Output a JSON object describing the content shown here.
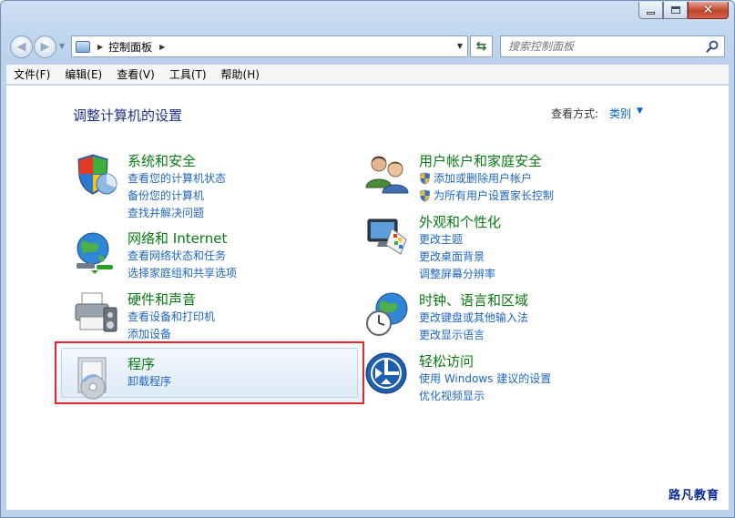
{
  "window": {
    "caption": {
      "minimize": "minimize",
      "maximize": "maximize",
      "close": "✕"
    }
  },
  "navbar": {
    "breadcrumb": "控制面板",
    "search_placeholder": "搜索控制面板"
  },
  "menubar": {
    "items": [
      "文件(F)",
      "编辑(E)",
      "查看(V)",
      "工具(T)",
      "帮助(H)"
    ]
  },
  "main": {
    "title": "调整计算机的设置",
    "view_by_label": "查看方式:",
    "view_by_value": "类别",
    "categories": {
      "system": {
        "title": "系统和安全",
        "links": [
          "查看您的计算机状态",
          "备份您的计算机",
          "查找并解决问题"
        ]
      },
      "network": {
        "title": "网络和 Internet",
        "links": [
          "查看网络状态和任务",
          "选择家庭组和共享选项"
        ]
      },
      "hardware": {
        "title": "硬件和声音",
        "links": [
          "查看设备和打印机",
          "添加设备"
        ]
      },
      "programs": {
        "title": "程序",
        "links": [
          "卸载程序"
        ]
      },
      "users": {
        "title": "用户帐户和家庭安全",
        "links": [
          "添加或删除用户帐户",
          "为所有用户设置家长控制"
        ]
      },
      "appearance": {
        "title": "外观和个性化",
        "links": [
          "更改主题",
          "更改桌面背景",
          "调整屏幕分辨率"
        ]
      },
      "clock": {
        "title": "时钟、语言和区域",
        "links": [
          "更改键盘或其他输入法",
          "更改显示语言"
        ]
      },
      "access": {
        "title": "轻松访问",
        "links": [
          "使用 Windows 建议的设置",
          "优化视频显示"
        ]
      }
    }
  },
  "watermark": "路凡教育",
  "colors": {
    "accent": "#1f66c2",
    "category_title": "#0a7a14",
    "highlight_border": "#e0282d"
  }
}
